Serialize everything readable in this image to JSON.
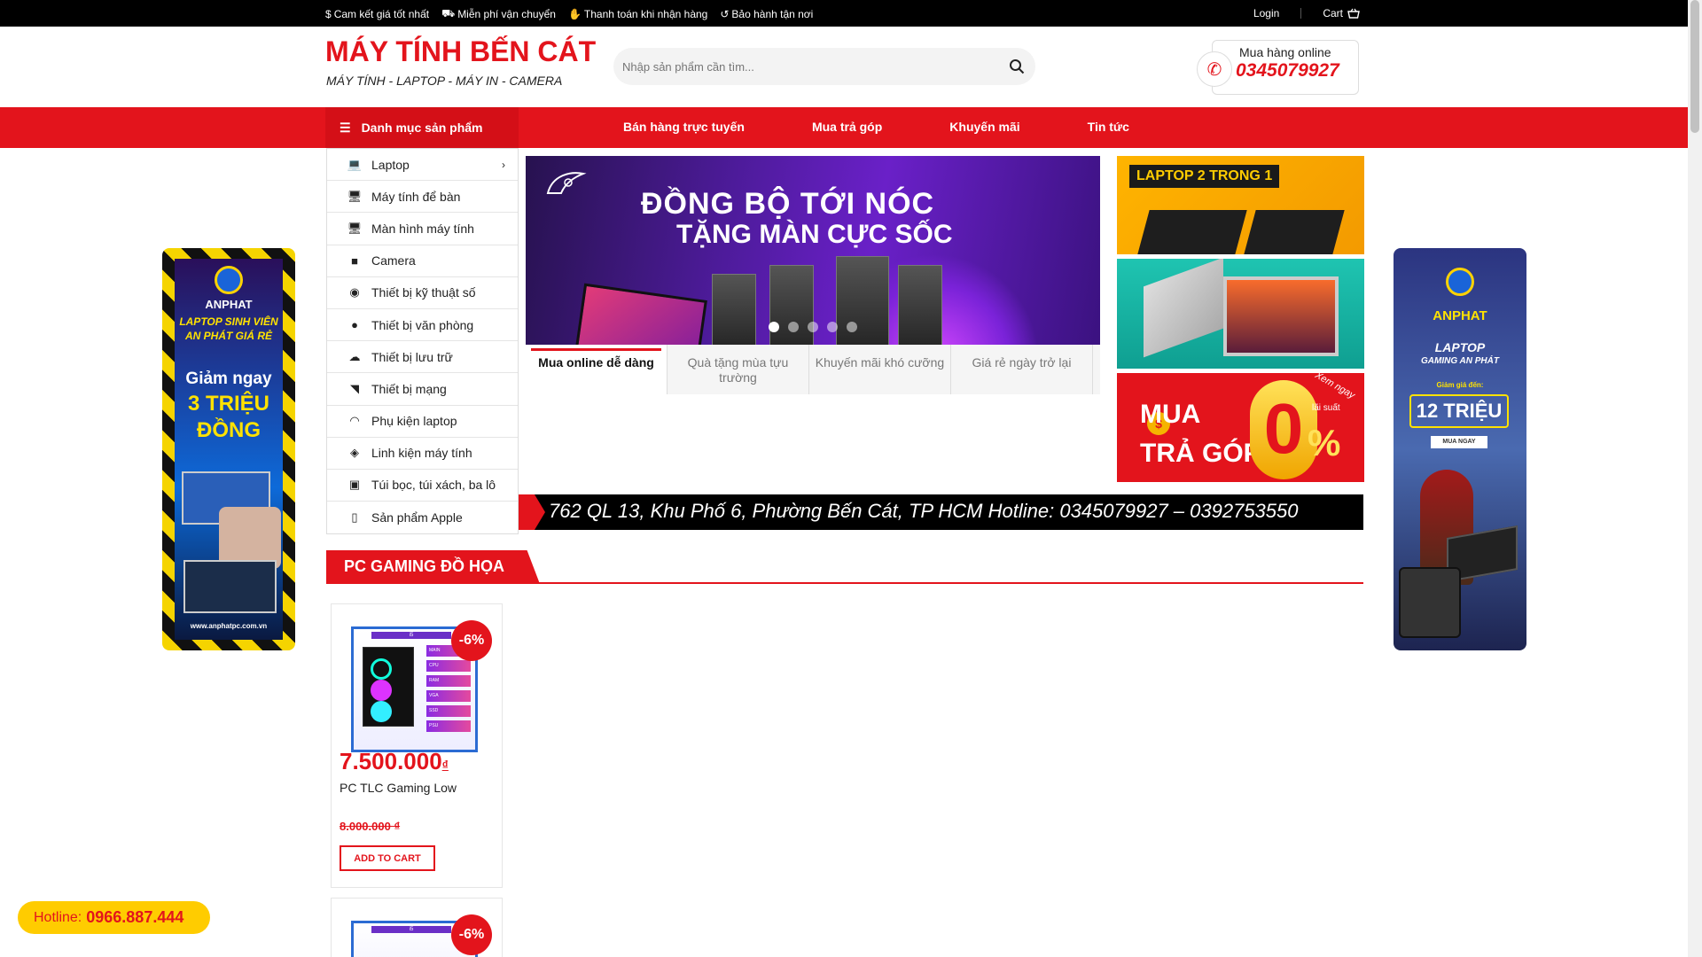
{
  "topbar": {
    "items": [
      "Cam kết giá tốt nhất",
      "Miễn phí vận chuyển",
      "Thanh toán khi nhận hàng",
      "Bảo hành tận nơi"
    ],
    "icons": [
      "dollar-icon",
      "truck-icon",
      "handshake-icon",
      "refresh-icon"
    ],
    "login": "Login",
    "cart": "Cart"
  },
  "header": {
    "title": "MÁY TÍNH BẾN CÁT",
    "subtitle": "MÁY TÍNH - LAPTOP - MÁY IN - CAMERA",
    "search_placeholder": "Nhập sản phẩm cần tìm...",
    "hotline_label": "Mua hàng online",
    "hotline_number": "0345079927"
  },
  "nav": {
    "category_button": "Danh mục sản phẩm",
    "links": [
      "Bán hàng trực tuyến",
      "Mua trả góp",
      "Khuyến mãi",
      "Tin tức"
    ]
  },
  "categories": [
    {
      "label": "Laptop",
      "icon": "laptop-icon",
      "has_sub": true
    },
    {
      "label": "Máy tính để bàn",
      "icon": "desktop-icon"
    },
    {
      "label": "Màn hình máy tính",
      "icon": "monitor-icon"
    },
    {
      "label": "Camera",
      "icon": "camera-video-icon"
    },
    {
      "label": "Thiết bị kỹ thuật số",
      "icon": "camera-icon"
    },
    {
      "label": "Thiết bị văn phòng",
      "icon": "user-icon"
    },
    {
      "label": "Thiết bị lưu trữ",
      "icon": "cloud-icon"
    },
    {
      "label": "Thiết bị mạng",
      "icon": "rss-icon"
    },
    {
      "label": "Phụ kiện laptop",
      "icon": "headphones-icon"
    },
    {
      "label": "Linh kiện máy tính",
      "icon": "cube-icon"
    },
    {
      "label": "Túi bọc, túi xách, ba lô",
      "icon": "briefcase-icon"
    },
    {
      "label": "Sản phẩm Apple",
      "icon": "mobile-icon"
    }
  ],
  "slider": {
    "headline_1": "ĐỒNG BỘ TỚI NÓC",
    "headline_2": "TẶNG MÀN CỰC SỐC",
    "slide_count": 5,
    "active_slide": 1
  },
  "tabs": [
    {
      "label": "Mua online dễ dàng",
      "active": true
    },
    {
      "label": "Quà tặng mùa tựu trường"
    },
    {
      "label": "Khuyến mãi khó cưỡng"
    },
    {
      "label": "Giá rẻ ngày trở lại"
    }
  ],
  "banners": {
    "b1_label": "LAPTOP 2 TRONG 1",
    "b3_line1": "MUA",
    "b3_line2": "TRẢ GÓP",
    "b3_zero": "0",
    "b3_pct": "%",
    "b3_xem": "Xem ngay",
    "b3_ls": "lãi suất"
  },
  "marquee": "762 QL 13, Khu Phố 6, Phường Bến Cát, TP HCM Hotline: 0345079927 – 0392753550",
  "section": {
    "title": "PC GAMING ĐỒ HỌA"
  },
  "products": [
    {
      "badge": "-6%",
      "price": "7.500.000",
      "currency": "₫",
      "name": "PC TLC Gaming Low",
      "old_price": "8.000.000 ₫",
      "button": "ADD TO CART"
    },
    {
      "badge": "-6%"
    }
  ],
  "ads": {
    "left_brand": "ANPHAT",
    "left_l1": "LAPTOP SINH VIÊN",
    "left_l2": "AN PHÁT GIÁ RẺ",
    "left_l3": "Giảm ngay",
    "left_l4": "3 TRIỆU",
    "left_l5": "ĐỒNG",
    "left_url": "www.anphatpc.com.vn",
    "right_brand": "ANPHAT",
    "right_l1": "LAPTOP",
    "right_l2": "GAMING AN PHÁT",
    "right_l3": "Giảm giá đến:",
    "right_l4": "12 TRIỆU",
    "right_btn": "MUA NGAY"
  },
  "hotline_float": {
    "label": "Hotline:",
    "number": "0966.887.444"
  },
  "colors": {
    "brand_red": "#e3141c",
    "topbar": "#000000",
    "hotline_bg": "#ffcc00"
  }
}
